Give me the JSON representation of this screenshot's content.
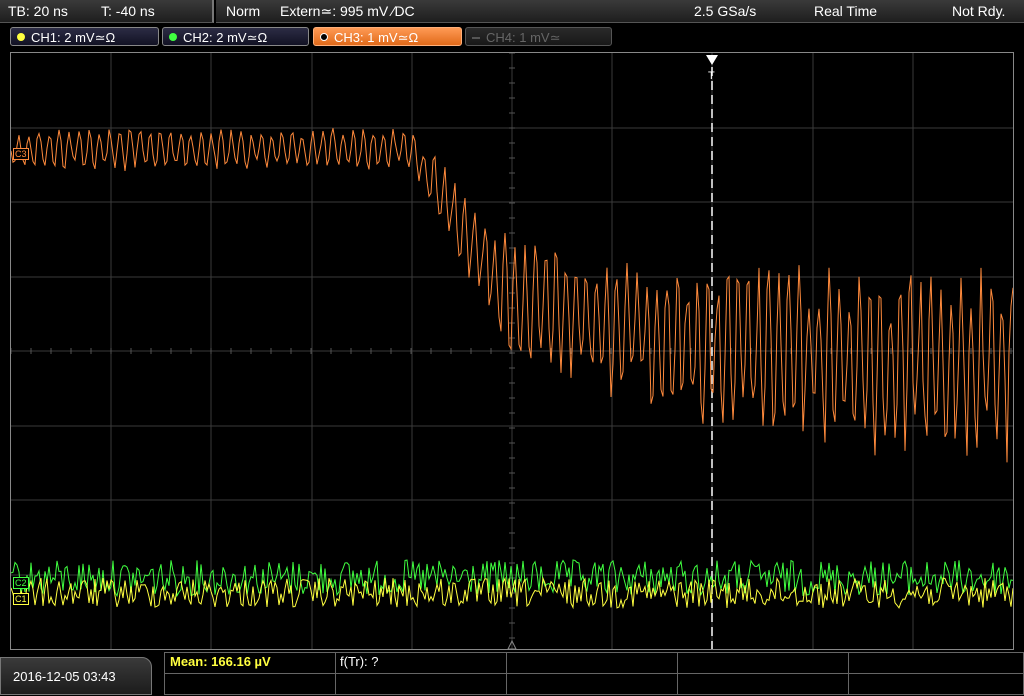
{
  "header": {
    "timebase": "TB: 20 ns",
    "trigger_time": "T: -40 ns",
    "mode": "Norm",
    "trigger_source": "Extern≃: 995 mV ∕DC",
    "sample_rate": "2.5 GSa/s",
    "acq_mode": "Real Time",
    "status": "Not Rdy."
  },
  "channels": [
    {
      "label": "CH1: 2 mV≃Ω",
      "color": "#ffff40",
      "active": true
    },
    {
      "label": "CH2: 2 mV≃Ω",
      "color": "#40ff40",
      "active": true
    },
    {
      "label": "CH3: 1 mV≃Ω",
      "color": "#ff8a3c",
      "active": true
    },
    {
      "label": "CH4: 1 mV≃",
      "color": "#666666",
      "active": false
    }
  ],
  "markers": {
    "ch3": "C3",
    "ch1": "C1",
    "ch2": "C2",
    "trigger": "T"
  },
  "measurements": {
    "mean": "Mean: 166.16 µV",
    "ftr": "f(Tr): ?"
  },
  "footer": {
    "datetime": "2016-12-05 03:43"
  },
  "colors": {
    "grid": "#3a3a3a",
    "ch1": "#ffff40",
    "ch2": "#40ff40",
    "ch3": "#ff8a3c",
    "trigger_line": "#ffffff"
  }
}
